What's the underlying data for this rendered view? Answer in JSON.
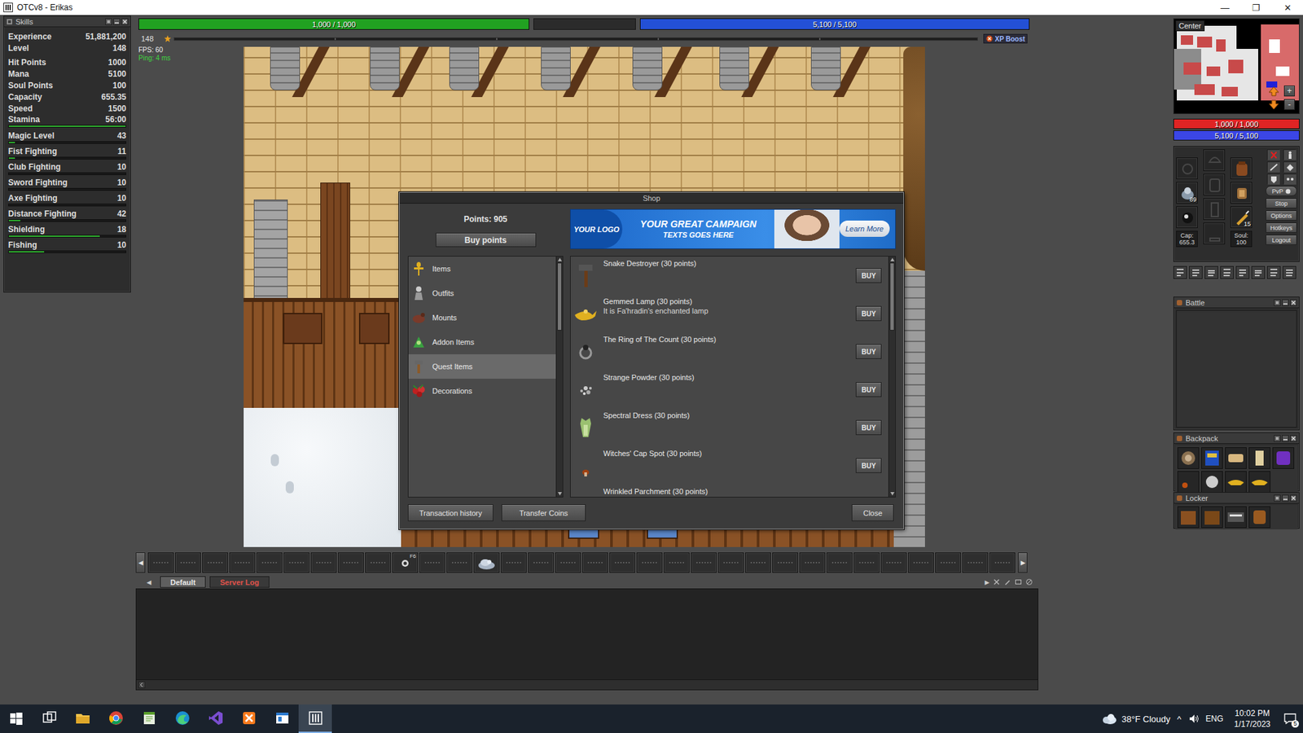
{
  "window": {
    "title": "OTCv8 - Erikas",
    "controls": [
      "—",
      "❐",
      "✕"
    ]
  },
  "skills": {
    "title": "Skills",
    "rows": [
      {
        "name": "Experience",
        "value": "51,881,200",
        "group": 1,
        "kind": "plain"
      },
      {
        "name": "Level",
        "value": "148",
        "group": 1,
        "kind": "plain"
      },
      {
        "name": "Hit Points",
        "value": "1000",
        "group": 2,
        "kind": "plain"
      },
      {
        "name": "Mana",
        "value": "5100",
        "group": 2,
        "kind": "plain"
      },
      {
        "name": "Soul Points",
        "value": "100",
        "group": 2,
        "kind": "plain"
      },
      {
        "name": "Capacity",
        "value": "655.35",
        "group": 2,
        "kind": "plain"
      },
      {
        "name": "Speed",
        "value": "1500",
        "group": 2,
        "kind": "plain"
      },
      {
        "name": "Stamina",
        "value": "56:00",
        "group": 2,
        "kind": "bar",
        "level": 1
      },
      {
        "name": "Magic Level",
        "value": "43",
        "group": 3,
        "kind": "bar",
        "level": 0.05
      },
      {
        "name": "Fist Fighting",
        "value": "11",
        "group": 3,
        "kind": "bar",
        "level": 0.05
      },
      {
        "name": "Club Fighting",
        "value": "10",
        "group": 3,
        "kind": "bar",
        "level": 0
      },
      {
        "name": "Sword Fighting",
        "value": "10",
        "group": 3,
        "kind": "bar",
        "level": 0
      },
      {
        "name": "Axe Fighting",
        "value": "10",
        "group": 3,
        "kind": "bar",
        "level": 0
      },
      {
        "name": "Distance Fighting",
        "value": "42",
        "group": 3,
        "kind": "bar",
        "level": 0.1
      },
      {
        "name": "Shielding",
        "value": "18",
        "group": 3,
        "kind": "bar",
        "level": 0.78
      },
      {
        "name": "Fishing",
        "value": "10",
        "group": 3,
        "kind": "bar",
        "level": 0.3
      }
    ]
  },
  "status": {
    "health": {
      "text": "1,000 / 1,000",
      "level": 1
    },
    "mana": {
      "text": "5,100 / 5,100",
      "level": 1
    },
    "level": "148",
    "experience": {
      "level": 0
    },
    "xp_boost": "XP Boost",
    "fps": "FPS: 60",
    "ping": "Ping: 4 ms"
  },
  "shop": {
    "title": "Shop",
    "points": "Points: 905",
    "buy_points": "Buy points",
    "banner": {
      "logo": "YOUR LOGO",
      "headline": "YOUR GREAT CAMPAIGN",
      "subline": "TEXTS GOES HERE",
      "button": "Learn More"
    },
    "categories": [
      {
        "label": "Items",
        "selected": false
      },
      {
        "label": "Outfits",
        "selected": false
      },
      {
        "label": "Mounts",
        "selected": false
      },
      {
        "label": "Addon Items",
        "selected": false
      },
      {
        "label": "Quest Items",
        "selected": true
      },
      {
        "label": "Decorations",
        "selected": false
      }
    ],
    "categories_scroll": {
      "level": 0
    },
    "items": [
      {
        "name": "Snake Destroyer (30 points)",
        "button": "BUY"
      },
      {
        "name": "Gemmed Lamp (30 points)",
        "description": "It is Fa'hradin's enchanted lamp",
        "button": "BUY"
      },
      {
        "name": "The Ring of The Count (30 points)",
        "button": "BUY"
      },
      {
        "name": "Strange Powder (30 points)",
        "button": "BUY"
      },
      {
        "name": "Spectral Dress (30 points)",
        "button": "BUY"
      },
      {
        "name": "Witches' Cap Spot (30 points)",
        "button": "BUY"
      },
      {
        "name": "Wrinkled Parchment (30 points)"
      }
    ],
    "scroll": {
      "level": 0
    },
    "buttons": {
      "history": "Transaction history",
      "transfer": "Transfer Coins",
      "close": "Close"
    }
  },
  "hotbar": {
    "left_arrow": "◀",
    "right_arrow": "▶",
    "slots": [
      {
        "filled": false
      },
      {
        "filled": false
      },
      {
        "filled": false
      },
      {
        "filled": false
      },
      {
        "filled": false
      },
      {
        "filled": false
      },
      {
        "filled": false
      },
      {
        "filled": false
      },
      {
        "filled": false
      },
      {
        "filled": true,
        "key": "F6"
      },
      {
        "filled": false
      },
      {
        "filled": false
      },
      {
        "filled": true
      },
      {
        "filled": false
      },
      {
        "filled": false
      },
      {
        "filled": false
      },
      {
        "filled": false
      },
      {
        "filled": false
      },
      {
        "filled": false
      },
      {
        "filled": false
      },
      {
        "filled": false
      },
      {
        "filled": false
      },
      {
        "filled": false
      },
      {
        "filled": false
      },
      {
        "filled": false
      },
      {
        "filled": false
      },
      {
        "filled": false
      },
      {
        "filled": false
      },
      {
        "filled": false
      },
      {
        "filled": false
      },
      {
        "filled": false
      },
      {
        "filled": false
      }
    ]
  },
  "chat": {
    "left_arrow": "◀",
    "right_arrow": "▶",
    "tabs": [
      {
        "label": "Default",
        "selected": true,
        "color": "#e8e8e8"
      },
      {
        "label": "Server Log",
        "selected": false,
        "color": "#e0524a"
      }
    ]
  },
  "right_panel": {
    "minimap": {
      "label": "Center",
      "zoom_in": "+",
      "zoom_out": "-"
    },
    "health": {
      "text": "1,000 / 1,000",
      "level": 1
    },
    "mana": {
      "text": "5,100 / 5,100",
      "level": 1
    },
    "inventory": {
      "slots": [
        {
          "filled": false
        },
        {
          "filled": true,
          "count": "89"
        },
        {
          "filled": true
        },
        {
          "filled": false
        },
        {
          "filled": false
        },
        {
          "filled": false
        },
        {
          "filled": false
        },
        {
          "filled": true
        },
        {
          "filled": true
        },
        {
          "filled": true,
          "count": "15"
        }
      ],
      "cap_label": "Cap:",
      "cap": "655.3",
      "soul_label": "Soul:",
      "soul": "100",
      "pvp": "PvP",
      "buttons": [
        "Stop",
        "Options",
        "Hotkeys",
        "Logout"
      ]
    },
    "battle": {
      "title": "Battle"
    },
    "backpack": {
      "title": "Backpack"
    },
    "locker": {
      "title": "Locker"
    }
  },
  "taskbar": {
    "apps": [
      {
        "selected": false
      },
      {
        "selected": false
      },
      {
        "selected": false
      },
      {
        "selected": false
      },
      {
        "selected": false
      },
      {
        "selected": false
      },
      {
        "selected": false
      },
      {
        "selected": false
      },
      {
        "selected": true
      }
    ],
    "weather": "38°F Cloudy",
    "tray_arrow": "^",
    "language": "ENG",
    "time": "10:02 PM",
    "date": "1/17/2023",
    "notifications": "5"
  }
}
